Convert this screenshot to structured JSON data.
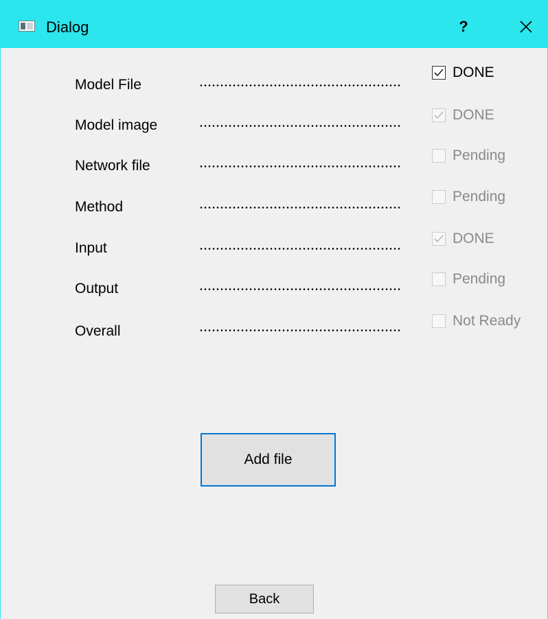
{
  "window": {
    "title": "Dialog",
    "help_label": "?",
    "icons": {
      "app": "window-icon",
      "close": "close-icon"
    }
  },
  "colors": {
    "titlebar": "#2be6ec",
    "focus_border": "#0078d7",
    "disabled_text": "#8a8a8a"
  },
  "rows": [
    {
      "label": "Model File",
      "status": "DONE",
      "checked": true,
      "enabled": true
    },
    {
      "label": "Model image",
      "status": "DONE",
      "checked": true,
      "enabled": false
    },
    {
      "label": "Network file",
      "status": "Pending",
      "checked": false,
      "enabled": false
    },
    {
      "label": "Method",
      "status": "Pending",
      "checked": false,
      "enabled": false
    },
    {
      "label": "Input",
      "status": "DONE",
      "checked": true,
      "enabled": false
    },
    {
      "label": "Output",
      "status": "Pending",
      "checked": false,
      "enabled": false
    },
    {
      "label": "Overall",
      "status": "Not Ready",
      "checked": false,
      "enabled": false
    }
  ],
  "buttons": {
    "add_file": "Add file",
    "back": "Back"
  }
}
